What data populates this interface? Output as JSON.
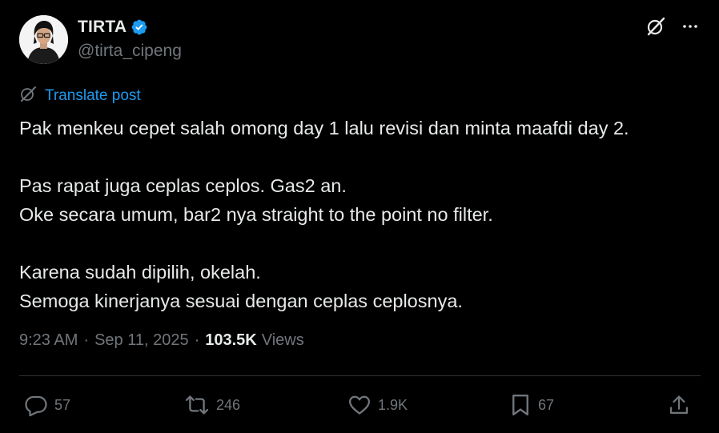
{
  "author": {
    "display_name": "TIRTA",
    "handle": "@tirta_cipeng",
    "verified": true
  },
  "translate": {
    "label": "Translate post"
  },
  "post": {
    "paragraphs": [
      [
        "Pak menkeu cepet salah omong day 1 lalu revisi dan minta maafdi day 2."
      ],
      [
        "Pas rapat juga ceplas ceplos. Gas2 an.",
        "Oke secara umum, bar2 nya straight to the point no filter."
      ],
      [
        "Karena sudah dipilih, okelah.",
        "Semoga kinerjanya sesuai dengan ceplas ceplosnya."
      ]
    ]
  },
  "meta": {
    "time": "9:23 AM",
    "separator": "·",
    "date": "Sep 11, 2025",
    "views_count": "103.5K",
    "views_label": "Views"
  },
  "actions": {
    "replies": "57",
    "reposts": "246",
    "likes": "1.9K",
    "bookmarks": "67"
  },
  "colors": {
    "background": "#000000",
    "text_primary": "#e7e9ea",
    "text_secondary": "#71767b",
    "accent": "#1d9bf0",
    "divider": "#2f3336"
  },
  "icons": {
    "verified": "verified-badge-icon",
    "grok": "grok-icon",
    "more": "more-icon",
    "translate": "translate-icon",
    "reply": "reply-icon",
    "repost": "repost-icon",
    "like": "heart-icon",
    "bookmark": "bookmark-icon",
    "share": "share-icon"
  }
}
